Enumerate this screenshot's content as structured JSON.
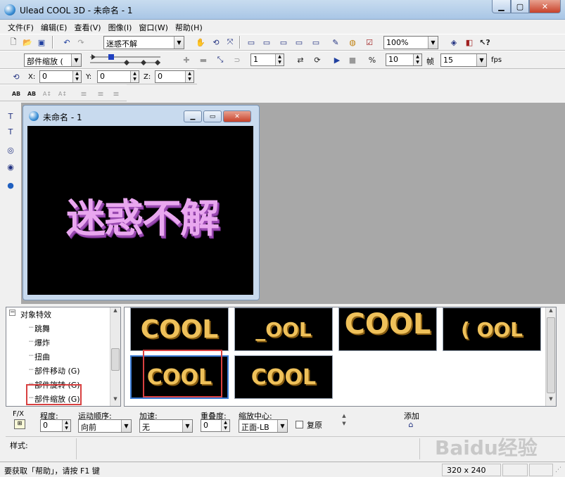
{
  "window": {
    "title": "Ulead COOL 3D - 未命名 - 1"
  },
  "menu": [
    "文件(F)",
    "编辑(E)",
    "查看(V)",
    "图像(I)",
    "窗口(W)",
    "帮助(H)"
  ],
  "toolbar": {
    "text_combo": "迷惑不解",
    "zoom_combo": "100%",
    "effect_combo": "部件缩放 (",
    "frame_value": "1",
    "frames_value": "10",
    "frames_label": "帧",
    "fps_value": "15",
    "fps_label": "fps"
  },
  "position": {
    "x_label": "X:",
    "x_value": "0",
    "y_label": "Y:",
    "y_value": "0",
    "z_label": "Z:",
    "z_value": "0"
  },
  "doc_window": {
    "title": "未命名 - 1",
    "canvas_text": "迷惑不解"
  },
  "tree": {
    "root": "对象特效",
    "items": [
      "跳舞",
      "爆炸",
      "扭曲",
      "部件移动 (G)",
      "部件旋转 (G)",
      "部件缩放 (G)"
    ]
  },
  "thumbnails": [
    "COOL",
    "_OOL",
    "COOL",
    "( OOL",
    "COOL",
    "COOL"
  ],
  "props": {
    "fx_label": "F/X",
    "degree_label": "程度:",
    "degree_value": "0",
    "order_label": "运动顺序:",
    "order_value": "向前",
    "accel_label": "加速:",
    "accel_value": "无",
    "overlap_label": "重叠度:",
    "overlap_value": "0",
    "center_label": "缩放中心:",
    "center_value": "正面-LB",
    "restore_label": "复原",
    "add_label": "添加"
  },
  "style_label": "样式:",
  "status": {
    "help": "要获取「帮助」，请按 F1 键",
    "size": "320 x 240"
  },
  "watermark": "Baidu经验",
  "colors": {
    "titlebar": "#b8d0ea",
    "canvas_bg": "#000000",
    "canvas_text": "#e9a7ef",
    "thumb_text": "#efc15a",
    "highlight": "#d84040",
    "workspace": "#a8a8a8"
  }
}
